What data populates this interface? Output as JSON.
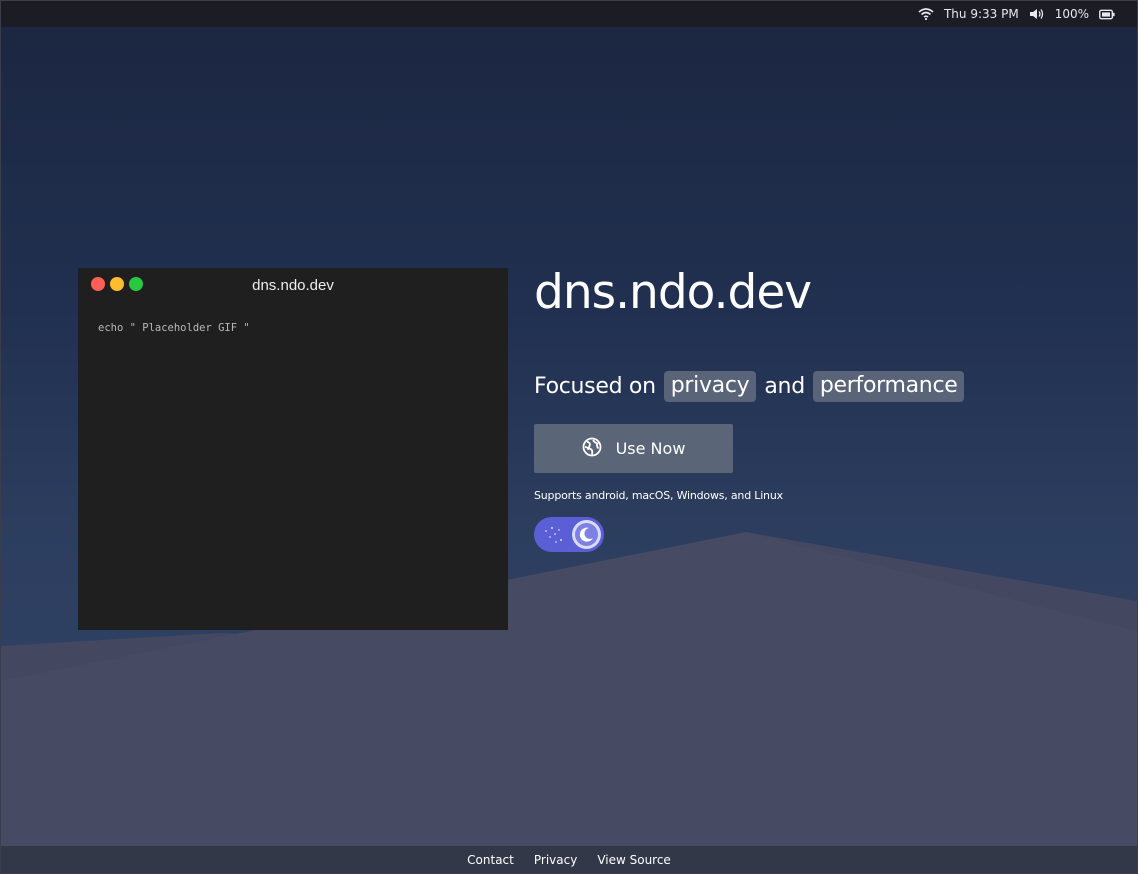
{
  "status_bar": {
    "datetime": "Thu 9:33 PM",
    "battery_percent": "100%",
    "icons": [
      "wifi-icon",
      "volume-icon",
      "battery-icon"
    ]
  },
  "terminal": {
    "title": "dns.ndo.dev",
    "command": "echo \" Placeholder GIF \""
  },
  "hero": {
    "title": "dns.ndo.dev",
    "tagline_prefix": "Focused on",
    "tagline_highlight_1": "privacy",
    "tagline_connector": "and",
    "tagline_highlight_2": "performance",
    "cta_label": "Use Now",
    "cta_icon": "globe-icon",
    "supports_text": "Supports android, macOS, Windows, and Linux"
  },
  "theme_toggle": {
    "state": "dark",
    "icon": "moon-icon"
  },
  "footer": {
    "links": [
      "Contact",
      "Privacy",
      "View Source"
    ]
  },
  "colors": {
    "background_top": "#1b2640",
    "background_bottom": "#34466a",
    "hill": "#454a61",
    "terminal_bg": "#1f1f1f",
    "button_bg": "#5b6578",
    "toggle_bg": "#5b5fd6",
    "footer_bg": "#333849"
  }
}
